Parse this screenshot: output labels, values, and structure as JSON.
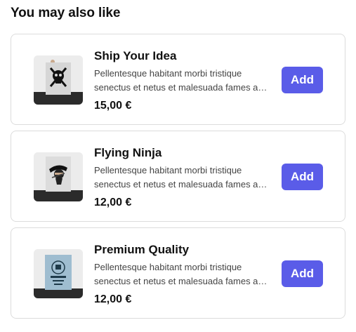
{
  "section": {
    "title": "You may also like"
  },
  "products": [
    {
      "name": "Ship Your Idea",
      "description_line1": "Pellentesque habitant morbi tristique",
      "description_line2": "senectus et netus et malesuada fames a…",
      "price": "15,00 €",
      "add_label": "Add",
      "image_icon": "skull-poster-icon"
    },
    {
      "name": "Flying Ninja",
      "description_line1": "Pellentesque habitant morbi tristique",
      "description_line2": "senectus et netus et malesuada fames a…",
      "price": "12,00 €",
      "add_label": "Add",
      "image_icon": "ninja-poster-icon"
    },
    {
      "name": "Premium Quality",
      "description_line1": "Pellentesque habitant morbi tristique",
      "description_line2": "senectus et netus et malesuada fames a…",
      "price": "12,00 €",
      "add_label": "Add",
      "image_icon": "badge-poster-icon"
    }
  ],
  "colors": {
    "accent": "#5a5ce8",
    "card_border": "#dcdcdc",
    "thumb_bg": "#ececec",
    "poster_blue": "#9fbdd0"
  }
}
